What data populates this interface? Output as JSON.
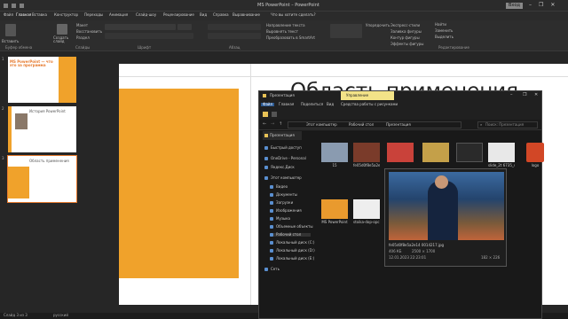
{
  "titlebar": {
    "title": "MS PowerPoint – PowerPoint",
    "signin": "Вход",
    "controls": [
      "–",
      "❐",
      "✕"
    ]
  },
  "tabs": [
    "Файл",
    "Главная",
    "Вставка",
    "Конструктор",
    "Переходы",
    "Анимация",
    "Слайд-шоу",
    "Рецензирование",
    "Вид",
    "Справка",
    "Выравнивание",
    "Что вы хотите сделать?"
  ],
  "ribbon": {
    "groups": [
      "Буфер обмена",
      "Слайды",
      "Шрифт",
      "Абзац",
      "Редактирование"
    ],
    "buttons": {
      "paste": "Вставить",
      "new_slide": "Создать слайд",
      "layout": "Макет",
      "reset": "Восстановить",
      "section": "Раздел",
      "find": "Найти",
      "replace": "Заменить",
      "select": "Выделить",
      "arrange": "Упорядочить",
      "quick_styles": "Экспресс-стили",
      "shape_fill": "Заливка фигуры",
      "shape_outline": "Контур фигуры",
      "shape_effects": "Эффекты фигуры",
      "text_direction": "Направление текста",
      "align_text": "Выровнять текст",
      "convert_smartart": "Преобразовать в SmartArt"
    }
  },
  "thumbnails": [
    {
      "num": "1",
      "title": "MS PowerPoint — что это за программа"
    },
    {
      "num": "2",
      "title": "История PowerPoint"
    },
    {
      "num": "3",
      "title": "Область применения"
    }
  ],
  "slide": {
    "title": "Область применения"
  },
  "statusbar": {
    "slide_info": "Слайд 3 из 3",
    "language": "русский"
  },
  "explorer": {
    "title": "Презентация",
    "context_tab": "Управление",
    "ribbon_tabs": [
      "Файл",
      "Главная",
      "Поделиться",
      "Вид",
      "Средства работы с рисунками"
    ],
    "address": [
      "Этот компьютер",
      "Рабочий стол",
      "Презентация"
    ],
    "search_placeholder": "Поиск: Презентация",
    "tab_chip": "Презентация",
    "nav": [
      "Быстрый доступ",
      "OneDrive - Personal",
      "Яндекс.Диск",
      "Этот компьютер",
      "Видео",
      "Документы",
      "Загрузки",
      "Изображения",
      "Музыка",
      "Объемные объекты",
      "Рабочий стол",
      "Локальный диск (C:)",
      "Локальный диск (D:)",
      "Локальный диск (E:)",
      "Сеть"
    ],
    "files": [
      {
        "name": "15",
        "color": "#8a9bb0"
      },
      {
        "name": "fe05d0f8e5a2e14 0014217",
        "color": "#7a3b2a"
      },
      {
        "name": "",
        "color": "#c9423a"
      },
      {
        "name": "",
        "color": "#c4a049"
      },
      {
        "name": "",
        "color": "#2a2a2a"
      },
      {
        "name": "",
        "color": "#e8e8e8"
      },
      {
        "name": "slide_2t 6735_4",
        "color": "#555"
      },
      {
        "name": "logo",
        "color": "#d24726"
      },
      {
        "name": "MS PowerPoint",
        "color": "#e99a2e"
      },
      {
        "name": "stoika-dop-opcii",
        "color": "#eeeeee"
      }
    ],
    "preview": {
      "filename": "fe05d0f8e5a2e14 0014217.jpg",
      "size": "406 КБ",
      "dims": "2500 × 1700",
      "date": "12.01.2023 22:23:01",
      "coords": "182 × 226"
    }
  }
}
